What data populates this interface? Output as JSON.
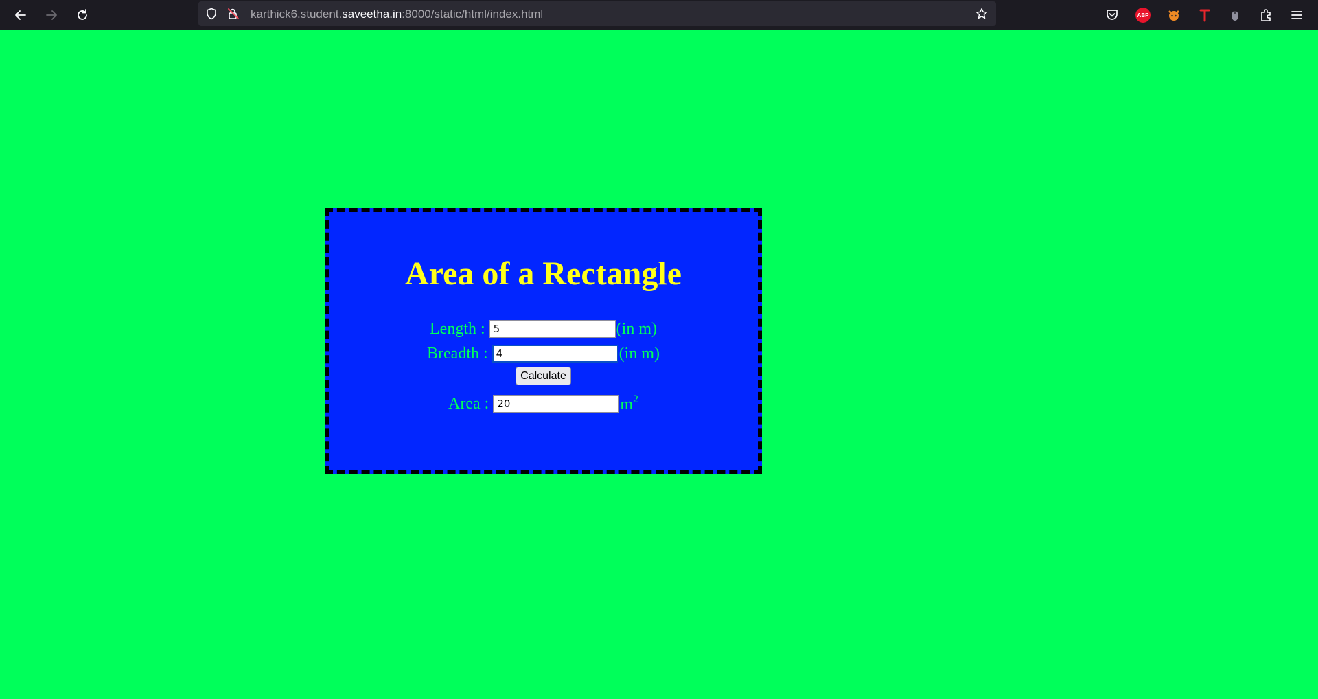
{
  "browser": {
    "url_prefix": "karthick6.student.",
    "url_domain": "saveetha.in",
    "url_suffix": ":8000/static/html/index.html",
    "extensions": [
      "pocket-icon",
      "adblock-plus-icon",
      "extension-fox-icon",
      "extension-t-icon",
      "extension-mouse-icon",
      "extensions-puzzle-icon"
    ],
    "abp_badge": "ABP"
  },
  "page": {
    "background": "#00ff5a",
    "card_background": "#0226ff",
    "title": "Area of a Rectangle",
    "title_color": "#ffff1a",
    "label_color": "#00ff5a",
    "length": {
      "label": "Length :",
      "value": "5",
      "unit": "(in m)"
    },
    "breadth": {
      "label": "Breadth :",
      "value": "4",
      "unit": "(in m)"
    },
    "calculate_label": "Calculate",
    "area": {
      "label": "Area :",
      "value": "20",
      "unit": "m",
      "unit_exponent": "2"
    }
  }
}
